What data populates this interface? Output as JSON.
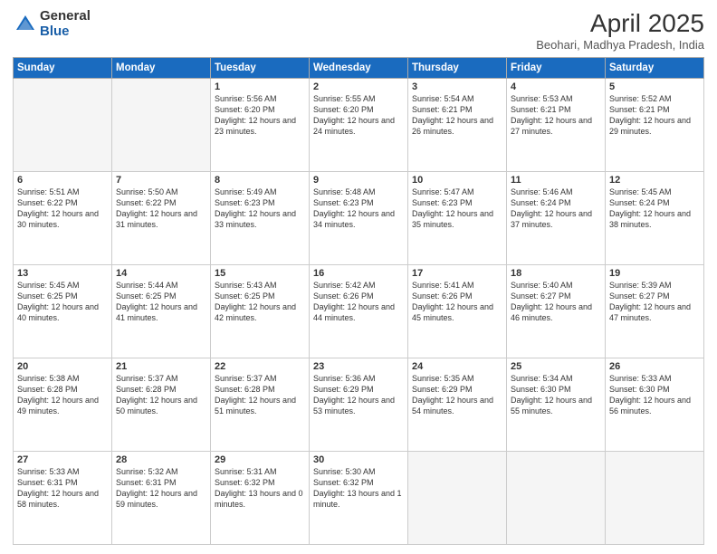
{
  "header": {
    "logo_general": "General",
    "logo_blue": "Blue",
    "month_title": "April 2025",
    "location": "Beohari, Madhya Pradesh, India"
  },
  "days_of_week": [
    "Sunday",
    "Monday",
    "Tuesday",
    "Wednesday",
    "Thursday",
    "Friday",
    "Saturday"
  ],
  "weeks": [
    [
      {
        "day": "",
        "detail": ""
      },
      {
        "day": "",
        "detail": ""
      },
      {
        "day": "1",
        "detail": "Sunrise: 5:56 AM\nSunset: 6:20 PM\nDaylight: 12 hours and 23 minutes."
      },
      {
        "day": "2",
        "detail": "Sunrise: 5:55 AM\nSunset: 6:20 PM\nDaylight: 12 hours and 24 minutes."
      },
      {
        "day": "3",
        "detail": "Sunrise: 5:54 AM\nSunset: 6:21 PM\nDaylight: 12 hours and 26 minutes."
      },
      {
        "day": "4",
        "detail": "Sunrise: 5:53 AM\nSunset: 6:21 PM\nDaylight: 12 hours and 27 minutes."
      },
      {
        "day": "5",
        "detail": "Sunrise: 5:52 AM\nSunset: 6:21 PM\nDaylight: 12 hours and 29 minutes."
      }
    ],
    [
      {
        "day": "6",
        "detail": "Sunrise: 5:51 AM\nSunset: 6:22 PM\nDaylight: 12 hours and 30 minutes."
      },
      {
        "day": "7",
        "detail": "Sunrise: 5:50 AM\nSunset: 6:22 PM\nDaylight: 12 hours and 31 minutes."
      },
      {
        "day": "8",
        "detail": "Sunrise: 5:49 AM\nSunset: 6:23 PM\nDaylight: 12 hours and 33 minutes."
      },
      {
        "day": "9",
        "detail": "Sunrise: 5:48 AM\nSunset: 6:23 PM\nDaylight: 12 hours and 34 minutes."
      },
      {
        "day": "10",
        "detail": "Sunrise: 5:47 AM\nSunset: 6:23 PM\nDaylight: 12 hours and 35 minutes."
      },
      {
        "day": "11",
        "detail": "Sunrise: 5:46 AM\nSunset: 6:24 PM\nDaylight: 12 hours and 37 minutes."
      },
      {
        "day": "12",
        "detail": "Sunrise: 5:45 AM\nSunset: 6:24 PM\nDaylight: 12 hours and 38 minutes."
      }
    ],
    [
      {
        "day": "13",
        "detail": "Sunrise: 5:45 AM\nSunset: 6:25 PM\nDaylight: 12 hours and 40 minutes."
      },
      {
        "day": "14",
        "detail": "Sunrise: 5:44 AM\nSunset: 6:25 PM\nDaylight: 12 hours and 41 minutes."
      },
      {
        "day": "15",
        "detail": "Sunrise: 5:43 AM\nSunset: 6:25 PM\nDaylight: 12 hours and 42 minutes."
      },
      {
        "day": "16",
        "detail": "Sunrise: 5:42 AM\nSunset: 6:26 PM\nDaylight: 12 hours and 44 minutes."
      },
      {
        "day": "17",
        "detail": "Sunrise: 5:41 AM\nSunset: 6:26 PM\nDaylight: 12 hours and 45 minutes."
      },
      {
        "day": "18",
        "detail": "Sunrise: 5:40 AM\nSunset: 6:27 PM\nDaylight: 12 hours and 46 minutes."
      },
      {
        "day": "19",
        "detail": "Sunrise: 5:39 AM\nSunset: 6:27 PM\nDaylight: 12 hours and 47 minutes."
      }
    ],
    [
      {
        "day": "20",
        "detail": "Sunrise: 5:38 AM\nSunset: 6:28 PM\nDaylight: 12 hours and 49 minutes."
      },
      {
        "day": "21",
        "detail": "Sunrise: 5:37 AM\nSunset: 6:28 PM\nDaylight: 12 hours and 50 minutes."
      },
      {
        "day": "22",
        "detail": "Sunrise: 5:37 AM\nSunset: 6:28 PM\nDaylight: 12 hours and 51 minutes."
      },
      {
        "day": "23",
        "detail": "Sunrise: 5:36 AM\nSunset: 6:29 PM\nDaylight: 12 hours and 53 minutes."
      },
      {
        "day": "24",
        "detail": "Sunrise: 5:35 AM\nSunset: 6:29 PM\nDaylight: 12 hours and 54 minutes."
      },
      {
        "day": "25",
        "detail": "Sunrise: 5:34 AM\nSunset: 6:30 PM\nDaylight: 12 hours and 55 minutes."
      },
      {
        "day": "26",
        "detail": "Sunrise: 5:33 AM\nSunset: 6:30 PM\nDaylight: 12 hours and 56 minutes."
      }
    ],
    [
      {
        "day": "27",
        "detail": "Sunrise: 5:33 AM\nSunset: 6:31 PM\nDaylight: 12 hours and 58 minutes."
      },
      {
        "day": "28",
        "detail": "Sunrise: 5:32 AM\nSunset: 6:31 PM\nDaylight: 12 hours and 59 minutes."
      },
      {
        "day": "29",
        "detail": "Sunrise: 5:31 AM\nSunset: 6:32 PM\nDaylight: 13 hours and 0 minutes."
      },
      {
        "day": "30",
        "detail": "Sunrise: 5:30 AM\nSunset: 6:32 PM\nDaylight: 13 hours and 1 minute."
      },
      {
        "day": "",
        "detail": ""
      },
      {
        "day": "",
        "detail": ""
      },
      {
        "day": "",
        "detail": ""
      }
    ]
  ]
}
